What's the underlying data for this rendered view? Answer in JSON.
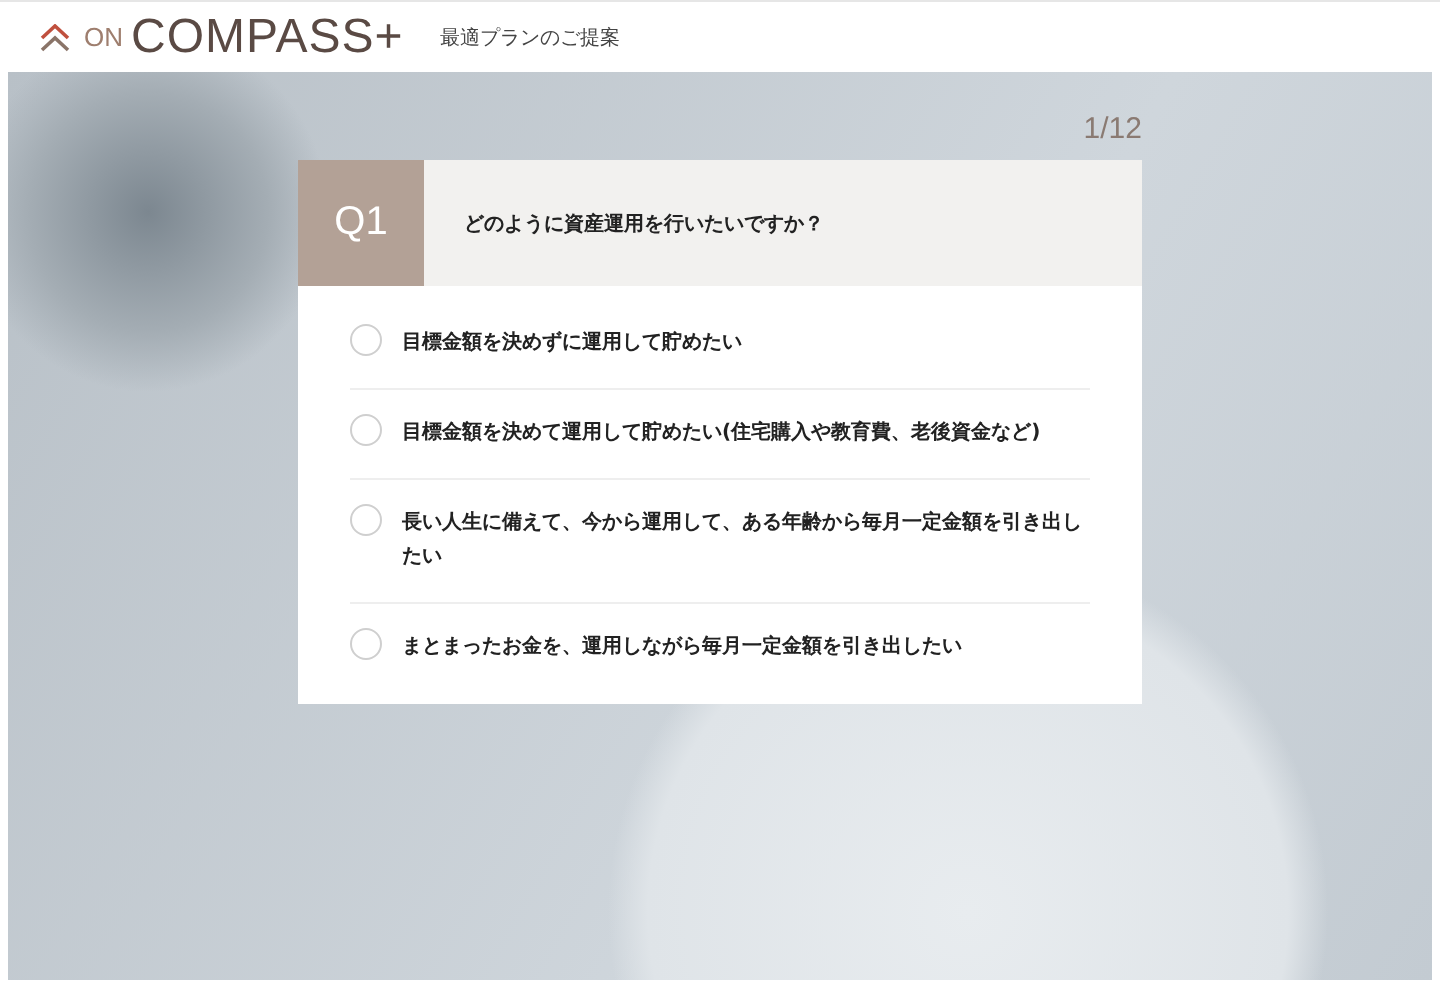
{
  "header": {
    "logo_prefix": "ON",
    "logo_name": "COMPASS+",
    "subtitle": "最適プランのご提案"
  },
  "question": {
    "counter": "1/12",
    "number": "Q1",
    "text": "どのように資産運用を行いたいですか？",
    "options": [
      {
        "label": "目標金額を決めずに運用して貯めたい",
        "selected": false
      },
      {
        "label": "目標金額を決めて運用して貯めたい(住宅購入や教育費、老後資金など)",
        "selected": false
      },
      {
        "label": "長い人生に備えて、今から運用して、ある年齢から毎月一定金額を引き出したい",
        "selected": false
      },
      {
        "label": "まとまったお金を、運用しながら毎月一定金額を引き出したい",
        "selected": false
      }
    ]
  }
}
